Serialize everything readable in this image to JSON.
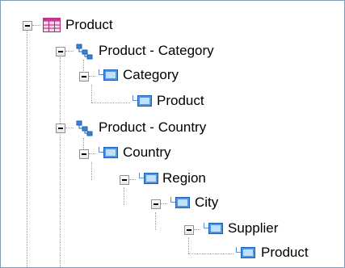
{
  "tree": {
    "root": {
      "label": "Product",
      "icon": "table-icon"
    },
    "hierarchies": [
      {
        "label": "Product - Category",
        "icon": "hierarchy-icon",
        "levels": [
          {
            "label": "Category",
            "icon": "level-icon"
          },
          {
            "label": "Product",
            "icon": "level-icon"
          }
        ]
      },
      {
        "label": "Product - Country",
        "icon": "hierarchy-icon",
        "levels": [
          {
            "label": "Country",
            "icon": "level-icon"
          },
          {
            "label": "Region",
            "icon": "level-icon"
          },
          {
            "label": "City",
            "icon": "level-icon"
          },
          {
            "label": "Supplier",
            "icon": "level-icon"
          },
          {
            "label": "Product",
            "icon": "level-icon"
          }
        ]
      }
    ]
  },
  "colors": {
    "border": "#7f9db9",
    "level_icon": "#2f78d6",
    "table_icon": "#c02a86"
  }
}
